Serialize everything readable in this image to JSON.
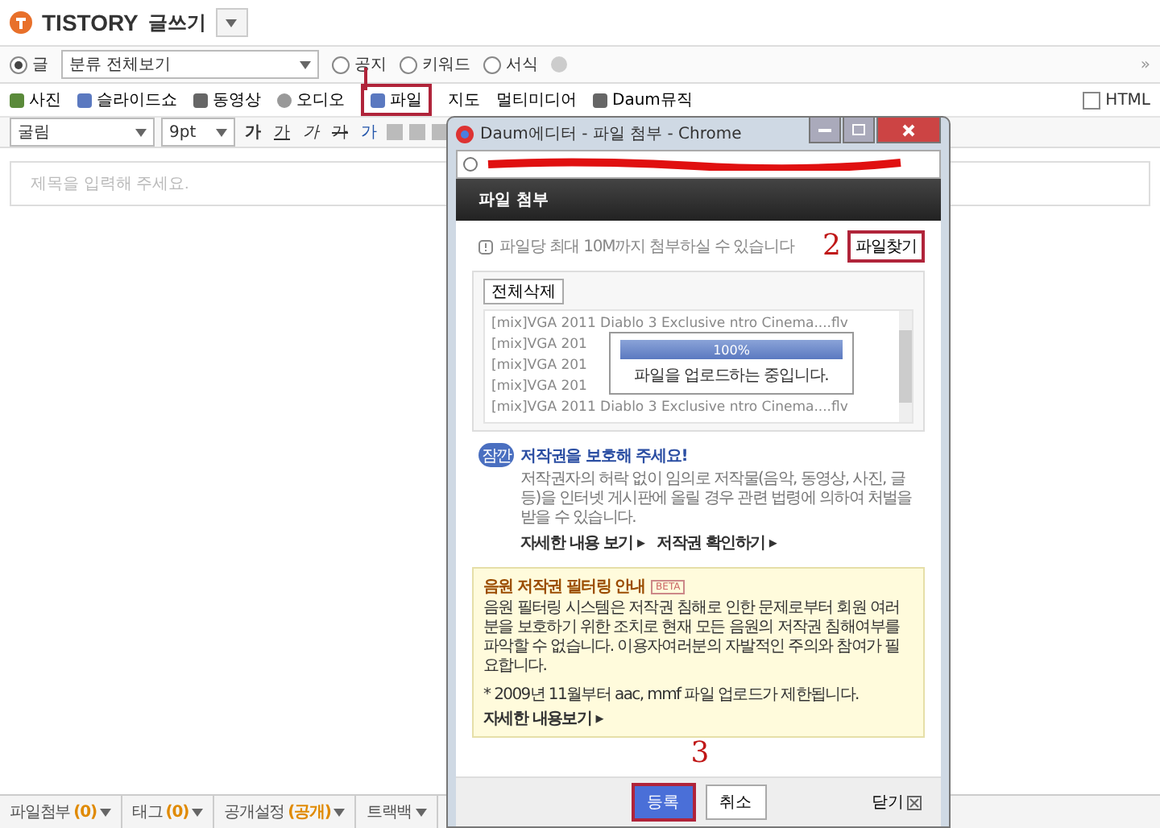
{
  "header": {
    "brand": "TISTORY",
    "title": "글쓰기"
  },
  "options": {
    "radios": [
      {
        "label": "글",
        "selected": true
      },
      {
        "label": "공지",
        "selected": false
      },
      {
        "label": "키워드",
        "selected": false
      },
      {
        "label": "서식",
        "selected": false
      }
    ],
    "category": "분류 전체보기",
    "more": "»"
  },
  "insert_toolbar": [
    {
      "label": "사진",
      "kind": "photo",
      "highlighted": false
    },
    {
      "label": "슬라이드쇼",
      "kind": "slides",
      "highlighted": false
    },
    {
      "label": "동영상",
      "kind": "video",
      "highlighted": false
    },
    {
      "label": "오디오",
      "kind": "audio",
      "highlighted": false
    },
    {
      "label": "파일",
      "kind": "file",
      "highlighted": true
    },
    {
      "label": "지도",
      "kind": "none",
      "highlighted": false
    },
    {
      "label": "멀티미디어",
      "kind": "none",
      "highlighted": false
    },
    {
      "label": "Daum뮤직",
      "kind": "music",
      "highlighted": false
    }
  ],
  "html_toggle": {
    "label": "HTML",
    "checked": false
  },
  "format_bar": {
    "font": "굴림",
    "size": "9pt",
    "styles": [
      {
        "label": "가",
        "kind": "bold"
      },
      {
        "label": "가",
        "kind": "underline"
      },
      {
        "label": "가",
        "kind": "italic"
      },
      {
        "label": "가",
        "kind": "strike"
      },
      {
        "label": "가",
        "kind": "color"
      }
    ]
  },
  "title_field": {
    "placeholder": "제목을 입력해 주세요."
  },
  "bottom_tabs": [
    {
      "label": "파일첨부",
      "count": "(0)"
    },
    {
      "label": "태그",
      "count": "(0)"
    },
    {
      "label": "공개설정",
      "count": "(공개)"
    },
    {
      "label": "트랙백"
    }
  ],
  "popup": {
    "window_title": "Daum에디터 - 파일 첨부 - Chrome",
    "header": "파일 첨부",
    "notice": "파일당 최대 10M까지 첨부하실 수 있습니다",
    "find_button": "파일찾기",
    "delete_all": "전체삭제",
    "files": [
      "[mix]VGA 2011 Diablo 3 Exclusive  ntro Cinema....flv",
      "[mix]VGA 201",
      "[mix]VGA 201",
      "[mix]VGA 201",
      "[mix]VGA 2011 Diablo 3 Exclusive  ntro Cinema....flv"
    ],
    "progress": {
      "level": 1,
      "reading": "100%",
      "message": "파일을 업로드하는 중입니다."
    },
    "copyright": {
      "badge": "잠깐",
      "title": "저작권을 보호해 주세요!",
      "text": "저작권자의 허락 없이 임의로 저작물(음악, 동영상, 사진, 글 등)을 인터넷 게시판에 올릴 경우 관련 법령에 의하여 처벌을 받을 수 있습니다.",
      "links": [
        "자세한 내용 보기 ▸",
        "저작권 확인하기 ▸"
      ]
    },
    "filter_box": {
      "title": "음원 저작권 필터링 안내",
      "badge": "BETA",
      "text": "음원 필터링 시스템은 저작권 침해로 인한 문제로부터 회원 여러분을 보호하기 위한 조치로 현재 모든 음원의 저작권 침해여부를 파악할 수 없습니다. 이용자여러분의 자발적인 주의와 참여가 필요합니다.",
      "note": "* 2009년 11월부터 aac, mmf 파일 업로드가 제한됩니다.",
      "link": "자세한 내용보기 ▸"
    },
    "buttons": {
      "submit": "등록",
      "cancel": "취소",
      "close": "닫기"
    }
  },
  "annotations": [
    "2",
    "3"
  ]
}
